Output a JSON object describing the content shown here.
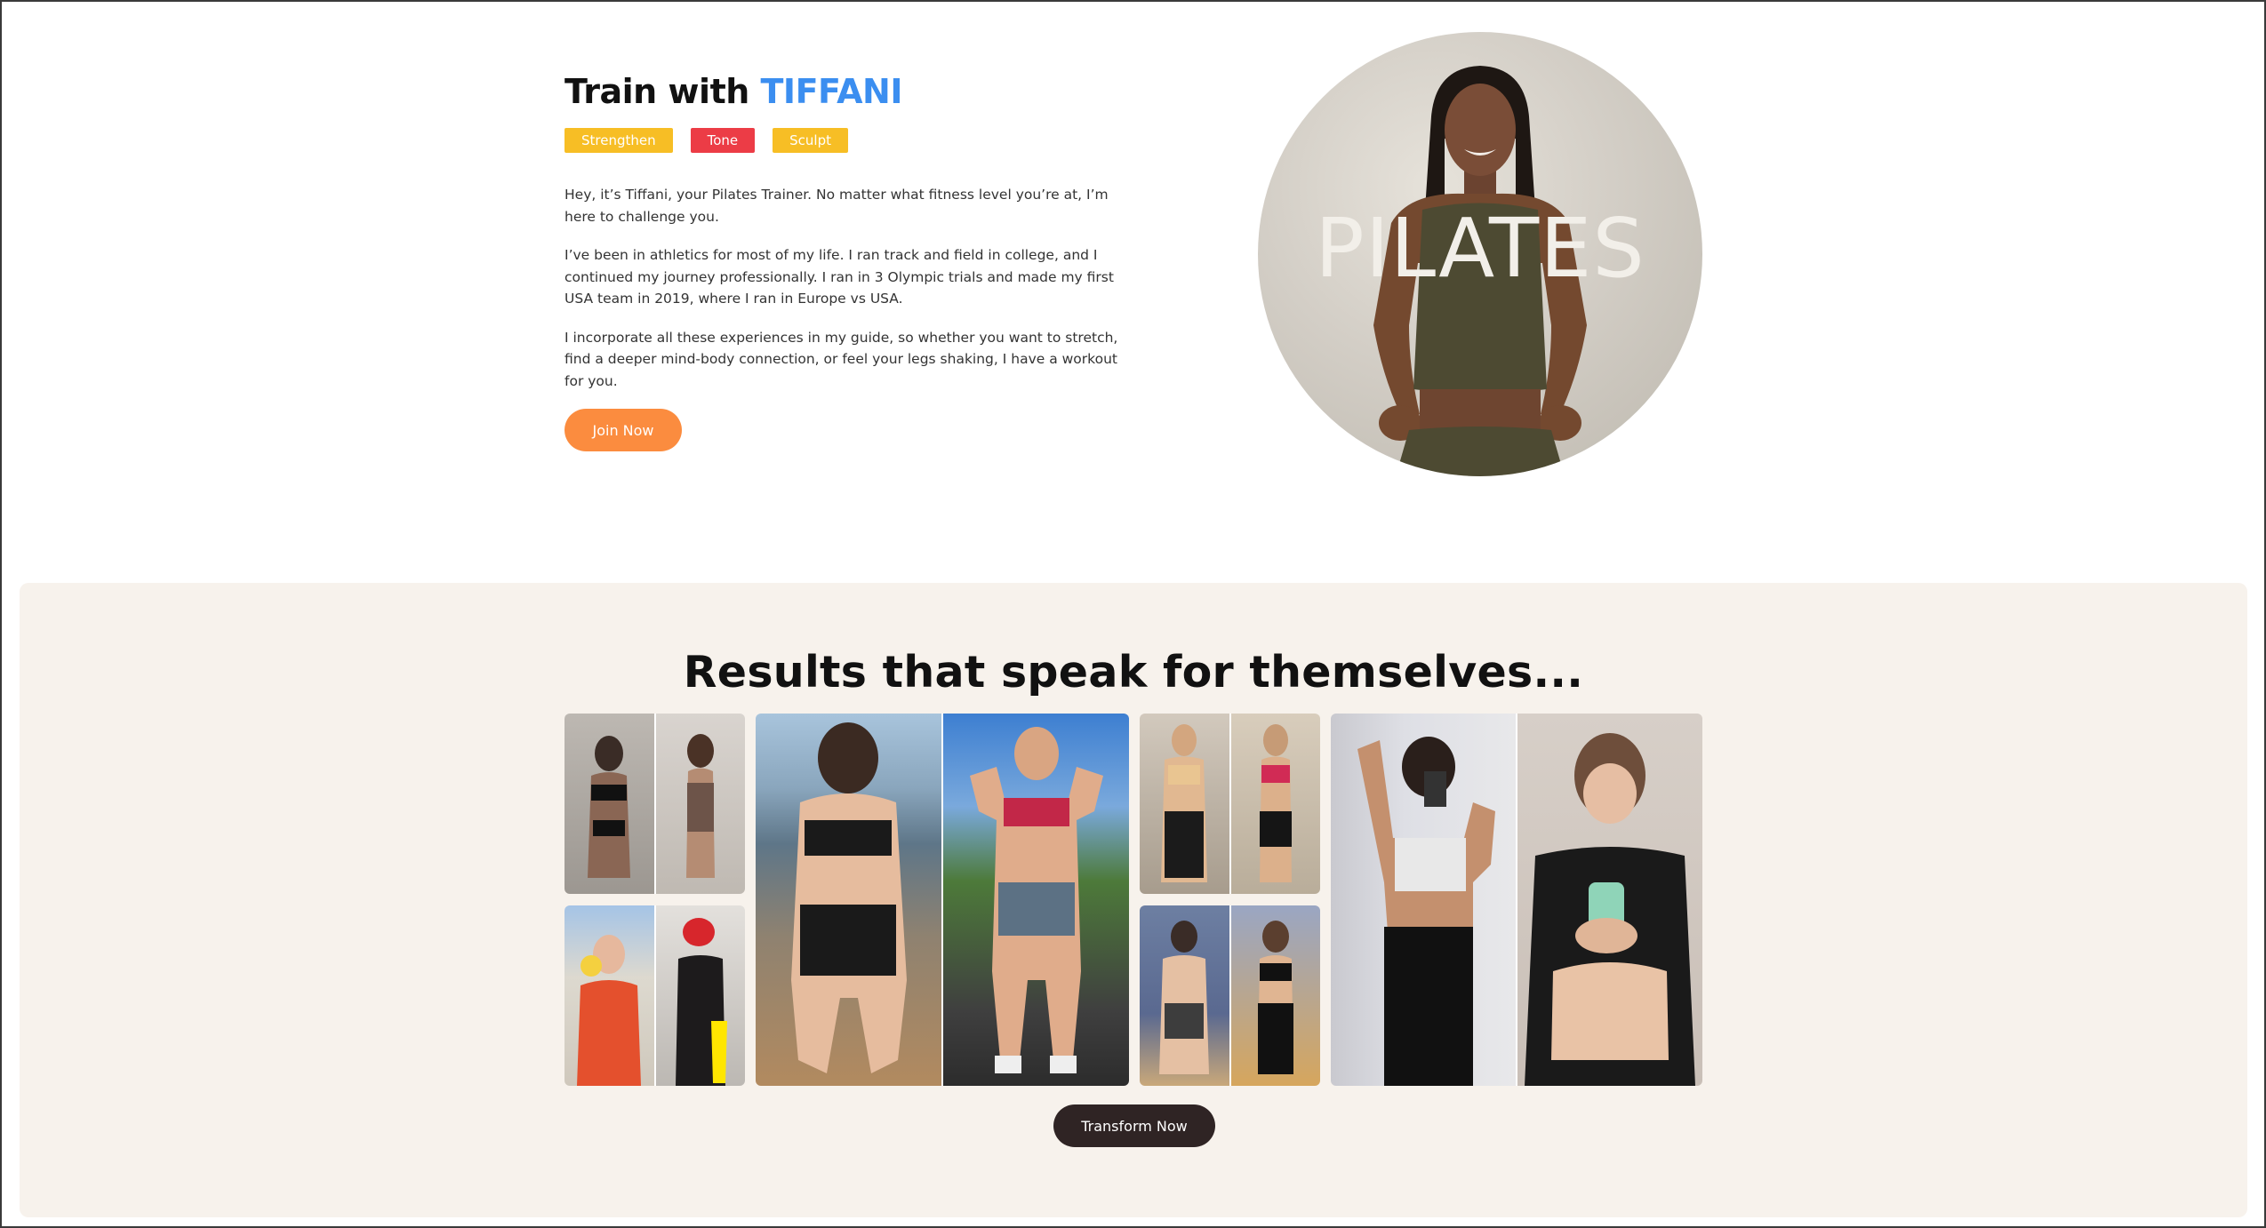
{
  "hero": {
    "title_prefix": "Train with ",
    "title_name": "TIFFANI",
    "tags": [
      "Strengthen",
      "Tone",
      "Sculpt"
    ],
    "paragraphs": [
      "Hey, it’s Tiffani, your Pilates Trainer. No matter what fitness level you’re at, I’m here to challenge you.",
      "I’ve been in athletics for most of my life. I ran track and field in college, and I continued my journey professionally. I ran in 3 Olympic trials and made my first USA team in 2019, where I ran in Europe vs USA.",
      "I incorporate all these experiences in my guide, so whether you want to stretch, find a deeper mind-body connection, or feel your legs shaking, I have a workout for you."
    ],
    "cta_label": "Join Now",
    "image_overlay_text": "PILATES"
  },
  "results": {
    "title": "Results that speak for themselves...",
    "cta_label": "Transform Now"
  },
  "colors": {
    "accent_blue": "#3b8ef0",
    "tag_yellow": "#f7be25",
    "tag_red": "#ec3c46",
    "join_orange": "#fb8c3f",
    "transform_dark": "#2f2424",
    "results_bg": "#f7f2ec"
  }
}
